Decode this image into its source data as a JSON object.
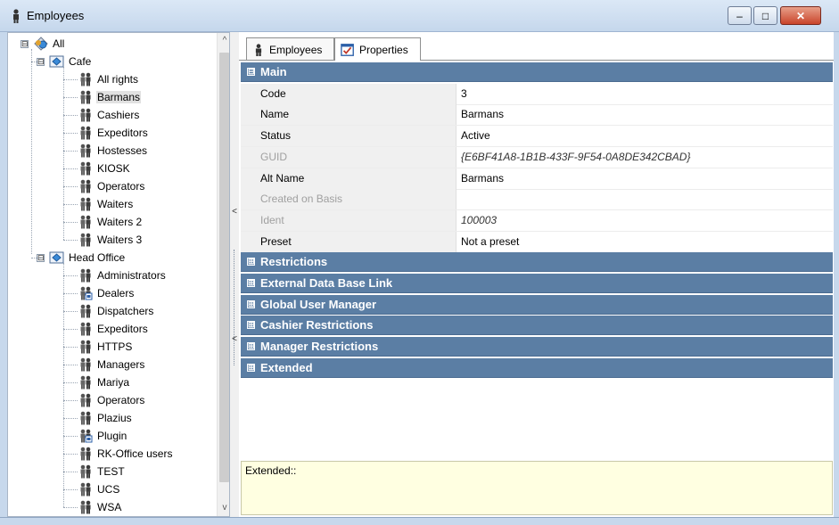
{
  "window": {
    "title": "Employees",
    "buttons": {
      "minimize": "–",
      "maximize": "□",
      "close": "✕"
    }
  },
  "tree": {
    "root": "All",
    "groups": [
      {
        "name": "Cafe",
        "items": [
          "All rights",
          "Barmans",
          "Cashiers",
          "Expeditors",
          "Hostesses",
          "KIOSK",
          "Operators",
          "Waiters",
          "Waiters 2",
          "Waiters 3"
        ]
      },
      {
        "name": "Head Office",
        "items": [
          "Administrators",
          "Dealers",
          "Dispatchers",
          "Expeditors",
          "HTTPS",
          "Managers",
          "Mariya",
          "Operators",
          "Plazius",
          "Plugin",
          "RK-Office users",
          "TEST",
          "UCS",
          "WSA"
        ]
      }
    ],
    "selected": "Barmans",
    "scroll_up": "^",
    "scroll_down": "v"
  },
  "splitter": {
    "grip": "<"
  },
  "tabs": [
    {
      "label": "Employees",
      "icon": "person-icon"
    },
    {
      "label": "Properties",
      "icon": "properties-icon"
    }
  ],
  "properties": {
    "main_section": "Main",
    "rows": [
      {
        "name": "Code",
        "value": "3",
        "disabled": false,
        "italic": false
      },
      {
        "name": "Name",
        "value": "Barmans",
        "disabled": false,
        "italic": false
      },
      {
        "name": "Status",
        "value": "Active",
        "disabled": false,
        "italic": false
      },
      {
        "name": "GUID",
        "value": "{E6BF41A8-1B1B-433F-9F54-0A8DE342CBAD}",
        "disabled": true,
        "italic": true
      },
      {
        "name": "Alt Name",
        "value": "Barmans",
        "disabled": false,
        "italic": false
      },
      {
        "name": "Created on Basis",
        "value": "",
        "disabled": true,
        "italic": false
      },
      {
        "name": "Ident",
        "value": "100003",
        "disabled": true,
        "italic": true
      },
      {
        "name": "Preset",
        "value": "Not a preset",
        "disabled": false,
        "italic": false
      }
    ],
    "collapsed_sections": [
      "Restrictions",
      "External Data Base Link",
      "Global User Manager",
      "Cashier Restrictions",
      "Manager Restrictions",
      "Extended"
    ],
    "expand_glyph": "⊞",
    "collapse_glyph": "⊟"
  },
  "extended_panel": {
    "text": "Extended::"
  },
  "colors": {
    "section_header": "#5b7ea4",
    "title_bar": "#dbe8f6",
    "info_panel": "#ffffe1",
    "selected_row": "#e1e1e1"
  }
}
